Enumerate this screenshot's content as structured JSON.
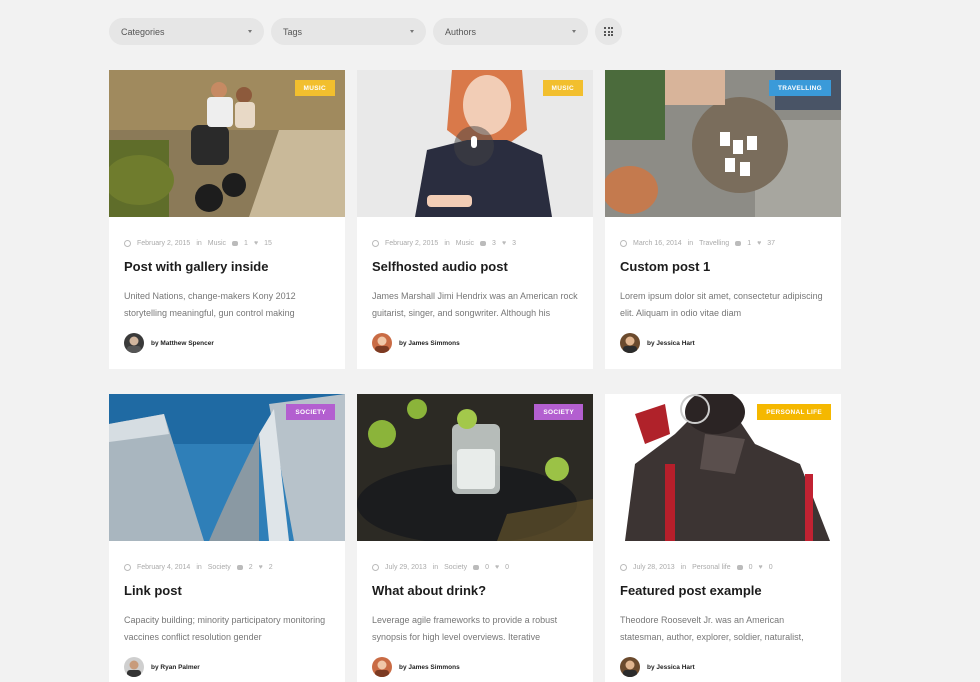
{
  "filters": [
    {
      "label": "Categories"
    },
    {
      "label": "Tags"
    },
    {
      "label": "Authors"
    }
  ],
  "posts": [
    {
      "badge": "MUSIC",
      "badge_color": "#f2bf2e",
      "date": "February 2, 2015",
      "in": "in",
      "category": "Music",
      "comments": "1",
      "likes": "15",
      "title": "Post with gallery inside",
      "excerpt": "United Nations, change-makers Kony 2012 storytelling meaningful, gun control making",
      "author": "by Matthew Spencer"
    },
    {
      "badge": "MUSIC",
      "badge_color": "#f2bf2e",
      "date": "February 2, 2015",
      "in": "in",
      "category": "Music",
      "comments": "3",
      "likes": "3",
      "title": "Selfhosted audio post",
      "excerpt": "James Marshall Jimi Hendrix was an American rock guitarist, singer, and songwriter. Although his",
      "author": "by James Simmons"
    },
    {
      "badge": "TRAVELLING",
      "badge_color": "#3a9ad9",
      "date": "March 16, 2014",
      "in": "in",
      "category": "Travelling",
      "comments": "1",
      "likes": "37",
      "title": "Custom post 1",
      "excerpt": "Lorem ipsum dolor sit amet, consectetur adipiscing elit. Aliquam in odio vitae diam",
      "author": "by Jessica Hart"
    },
    {
      "badge": "SOCIETY",
      "badge_color": "#b35fd0",
      "date": "February 4, 2014",
      "in": "in",
      "category": "Society",
      "comments": "2",
      "likes": "2",
      "title": "Link post",
      "excerpt": "Capacity building; minority participatory monitoring vaccines conflict resolution gender",
      "author": "by Ryan Palmer"
    },
    {
      "badge": "SOCIETY",
      "badge_color": "#b35fd0",
      "date": "July 29, 2013",
      "in": "in",
      "category": "Society",
      "comments": "0",
      "likes": "0",
      "title": "What about drink?",
      "excerpt": "Leverage agile frameworks to provide a robust synopsis for high level overviews. Iterative",
      "author": "by James Simmons"
    },
    {
      "badge": "PERSONAL LIFE",
      "badge_color": "#f5b800",
      "date": "July 28, 2013",
      "in": "in",
      "category": "Personal life",
      "comments": "0",
      "likes": "0",
      "title": "Featured post example",
      "excerpt": "Theodore Roosevelt Jr. was an American statesman, author, explorer, soldier, naturalist,",
      "author": "by Jessica Hart"
    }
  ]
}
